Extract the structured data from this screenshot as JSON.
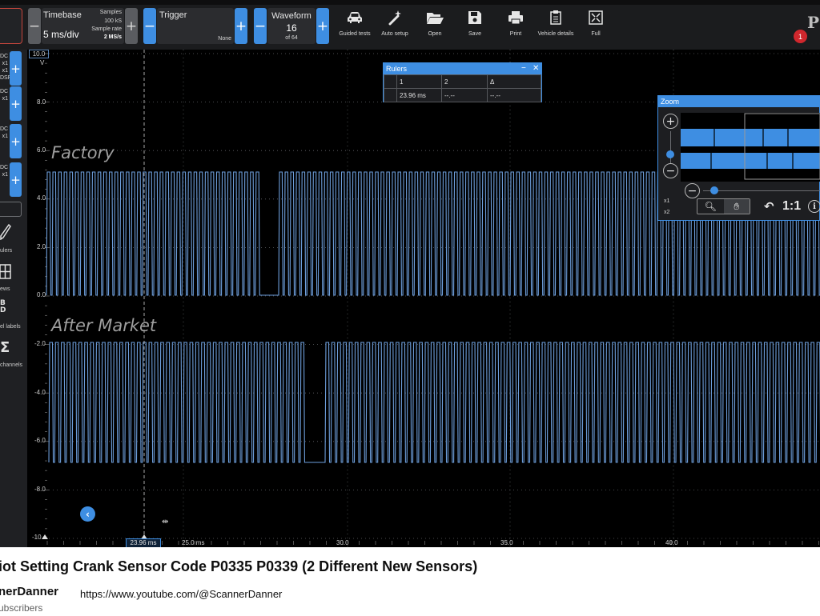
{
  "toolbar": {
    "timebase": {
      "label": "Timebase",
      "value": "5 ms/div",
      "samples_label": "Samples",
      "samples_value": "100 kS",
      "rate_label": "Sample rate",
      "rate_value": "2 MS/s"
    },
    "trigger": {
      "label": "Trigger",
      "mode": "None"
    },
    "waveform": {
      "label": "Waveform",
      "current": "16",
      "of": "of 64"
    },
    "tools": [
      {
        "label": "Guided tests",
        "icon": "car-icon"
      },
      {
        "label": "Auto setup",
        "icon": "magic-wand-icon"
      },
      {
        "label": "Open",
        "icon": "folder-open-icon"
      },
      {
        "label": "Save",
        "icon": "floppy-disk-icon"
      },
      {
        "label": "Print",
        "icon": "printer-icon"
      },
      {
        "label": "Vehicle details",
        "icon": "clipboard-icon"
      },
      {
        "label": "Full",
        "icon": "fullscreen-icon"
      }
    ],
    "notification_count": "1",
    "logo_letter": "P"
  },
  "channels": [
    {
      "line1": "DC",
      "line2": "x1",
      "line3": "x1",
      "line4": "DSP"
    },
    {
      "line1": "DC",
      "line2": "x1",
      "line3": "",
      "line4": ""
    },
    {
      "line1": "DC",
      "line2": "x1",
      "line3": "",
      "line4": ""
    },
    {
      "line1": "DC",
      "line2": "x1",
      "line3": "",
      "line4": ""
    }
  ],
  "left_tools": [
    {
      "label": "Rulers",
      "icon": "pencil-icon",
      "shown": "ulers"
    },
    {
      "label": "Views",
      "icon": "grid-icon",
      "shown": "ews"
    },
    {
      "label": "Channel labels",
      "icon": "abcd-icon",
      "shown": "el labels"
    },
    {
      "label": "Math channels",
      "icon": "sigma-icon",
      "shown": "channels"
    }
  ],
  "scope": {
    "scale_top": "10.0",
    "scale_unit": "V",
    "y_labels": [
      "8.0",
      "6.0",
      "4.0",
      "2.0",
      "0.0",
      "-2.0",
      "-4.0",
      "-6.0",
      "-8.0",
      "-10"
    ],
    "x_labels": [
      "25.0 ms",
      "30.0",
      "35.0",
      "40.0"
    ],
    "ruler_readout": "23.96 ms",
    "waveform_labels": [
      "Factory",
      "After Market"
    ],
    "colors": {
      "trace": "#6d9edb",
      "grid": "#5f6266",
      "accent": "#3e8ee2"
    }
  },
  "rulers_window": {
    "title": "Rulers",
    "headers": [
      "1",
      "2",
      "Δ"
    ],
    "values": [
      "23.96 ms",
      "--.--",
      "--.--"
    ]
  },
  "zoom_window": {
    "title": "Zoom",
    "labels": [
      "x1",
      "x2"
    ],
    "one_to_one": "1:1"
  },
  "video": {
    "title": "iot Setting Crank Sensor Code P0335 P0339 (2 Different New Sensors)",
    "channel": "nerDanner",
    "subscribers": "ubscribers",
    "url": "https://www.youtube.com/@ScannerDanner"
  }
}
